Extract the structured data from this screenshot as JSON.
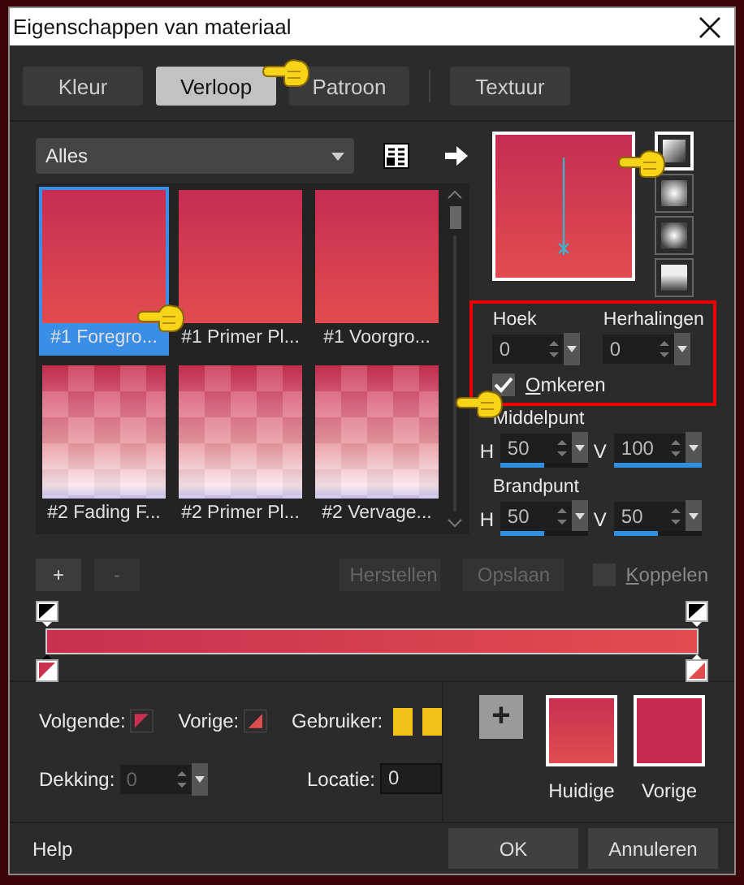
{
  "window": {
    "title": "Eigenschappen van materiaal"
  },
  "tabs": [
    {
      "label": "Kleur",
      "selected": false
    },
    {
      "label": "Verloop",
      "selected": true
    },
    {
      "label": "Patroon",
      "selected": false
    },
    {
      "label": "Textuur",
      "selected": false
    }
  ],
  "library": {
    "category": "Alles"
  },
  "presets": [
    {
      "label": "#1 Foregro...",
      "kind": "solid",
      "selected": true
    },
    {
      "label": "#1 Primer Pl...",
      "kind": "solid",
      "selected": false
    },
    {
      "label": "#1 Voorgro...",
      "kind": "solid",
      "selected": false
    },
    {
      "label": "#2 Fading F...",
      "kind": "checker",
      "selected": false
    },
    {
      "label": "#2 Primer Pl...",
      "kind": "checker",
      "selected": false
    },
    {
      "label": "#2 Vervage...",
      "kind": "checker",
      "selected": false
    }
  ],
  "styles": [
    {
      "kind": "linear",
      "selected": true
    },
    {
      "kind": "rectangular",
      "selected": false
    },
    {
      "kind": "radial",
      "selected": false
    },
    {
      "kind": "sunburst",
      "selected": false
    }
  ],
  "angle": {
    "label": "Hoek",
    "value": "0"
  },
  "repeats": {
    "label": "Herhalingen",
    "value": "0"
  },
  "invert": {
    "label": "Omkeren",
    "checked": true
  },
  "center": {
    "label": "Middelpunt",
    "h": {
      "label": "H",
      "value": "50",
      "level": 0.5
    },
    "v": {
      "label": "V",
      "value": "100",
      "level": 1
    }
  },
  "focal": {
    "label": "Brandpunt",
    "h": {
      "label": "H",
      "value": "50",
      "level": 0.5
    },
    "v": {
      "label": "V",
      "value": "50",
      "level": 0.5
    }
  },
  "link": {
    "label": "Koppelen",
    "checked": false
  },
  "stop_buttons": [
    {
      "label": "+",
      "disabled": false
    },
    {
      "label": "-",
      "disabled": true
    }
  ],
  "file_buttons": [
    {
      "label": "Herstellen",
      "disabled": true
    },
    {
      "label": "Opslaan",
      "disabled": true
    }
  ],
  "stop_colors": [
    {
      "label": "Volgende:"
    },
    {
      "label": "Vorige:"
    }
  ],
  "user": {
    "label": "Gebruiker:"
  },
  "opacity": {
    "label": "Dekking:",
    "value": "0",
    "disabled": true
  },
  "location": {
    "label": "Locatie:",
    "value": "0"
  },
  "add_button": {
    "label": "+"
  },
  "swatches": [
    {
      "label": "Huidige",
      "kind": "gradient"
    },
    {
      "label": "Vorige",
      "kind": "solid"
    }
  ],
  "footer": {
    "help": "Help",
    "buttons": [
      {
        "label": "OK"
      },
      {
        "label": "Annuleren"
      }
    ]
  }
}
